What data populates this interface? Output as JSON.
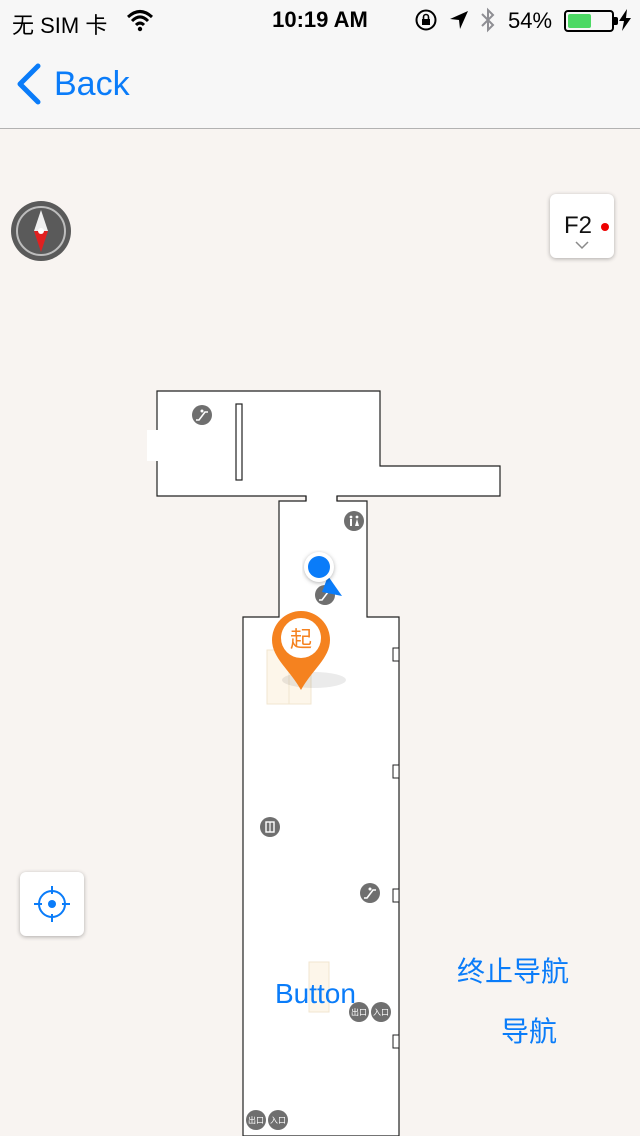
{
  "status_bar": {
    "carrier": "无 SIM 卡",
    "time": "10:19 AM",
    "battery_percent": "54%",
    "battery_level": 0.54,
    "icons": [
      "wifi-icon",
      "orientation-lock-icon",
      "location-arrow-icon",
      "bluetooth-icon",
      "battery-icon",
      "charging-bolt-icon"
    ]
  },
  "nav_bar": {
    "back_label": "Back",
    "back_icon": "chevron-left-icon"
  },
  "map": {
    "floor_selector": {
      "label": "F2",
      "indicator_color": "#e00000"
    },
    "compass_icon": "compass-icon",
    "locate_icon": "crosshair-icon",
    "start_marker_label": "起",
    "buttons": {
      "generic": "Button",
      "stop_navigation": "终止导航",
      "navigate": "导航"
    },
    "poi_labels": {
      "exit": "出口",
      "entrance": "入口"
    }
  },
  "colors": {
    "accent": "#0a7cf9",
    "map_background": "#f8f4f1",
    "marker_orange": "#f5821f",
    "user_dot": "#0a7cf9"
  }
}
